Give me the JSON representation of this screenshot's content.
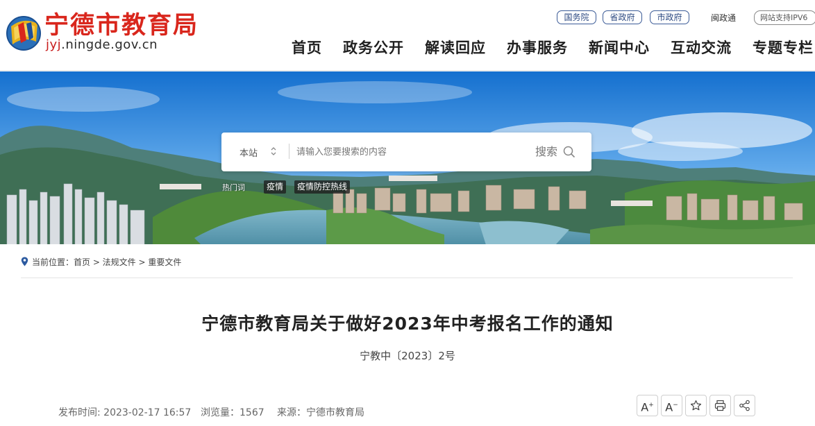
{
  "header": {
    "site_name": "宁德市教育局",
    "domain_prefix": "jyj",
    "domain_rest": ".ningde.gov.cn",
    "top_links": [
      "国务院",
      "省政府",
      "市政府"
    ],
    "minzhengtong": "闽政通",
    "ipv6": "网站支持IPV6"
  },
  "nav": {
    "items": [
      "首页",
      "政务公开",
      "解读回应",
      "办事服务",
      "新闻中心",
      "互动交流",
      "专题专栏"
    ]
  },
  "search": {
    "scope": "本站",
    "placeholder": "请输入您要搜索的内容",
    "button": "搜索"
  },
  "hot": {
    "label": "热门词",
    "tags": [
      "疫情",
      "疫情防控热线"
    ]
  },
  "breadcrumb": {
    "text": "当前位置：首页 > 法规文件 > 重要文件"
  },
  "article": {
    "title": "宁德市教育局关于做好2023年中考报名工作的通知",
    "doc_no": "宁教中〔2023〕2号",
    "publish": "发布时间: 2023-02-17 16:57",
    "views": "浏览量：1567",
    "source": "来源：宁德市教育局"
  },
  "tools": {
    "font_larger": "A",
    "font_smaller": "A",
    "plus": "+",
    "minus": "−"
  },
  "colors": {
    "brand_red": "#d9261c",
    "link_blue": "#2d4a82",
    "sky_top": "#1f7fd6"
  }
}
